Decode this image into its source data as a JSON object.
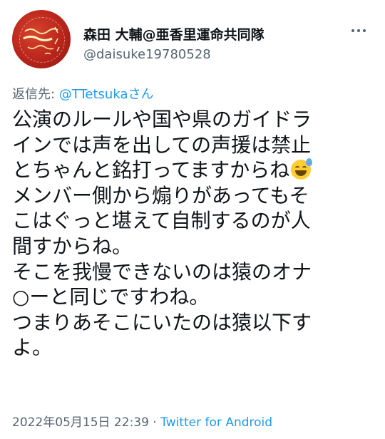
{
  "tweet": {
    "author": {
      "display_name": "森田 大輔@亜香里運命共同隊",
      "handle": "@daisuke19780528"
    },
    "reply": {
      "label": "返信先: ",
      "target": "@TTetsukaさん"
    },
    "body_lines": [
      "公演のルールや国や県のガイドラ",
      "インでは声を出しての声援は禁止",
      "とちゃんと銘打ってますからね",
      "メンバー側から煽りがあってもそ",
      "こはぐっと堪えて自制するのが人",
      "間すからね。",
      "そこを我慢できないのは猿のオナ",
      "○ーと同じですわね。",
      "つまりあそこにいたのは猿以下す",
      "よ。"
    ],
    "emoji": "grinning-face-with-sweat",
    "meta": {
      "timestamp": "2022年05月15日 22:39",
      "separator": " · ",
      "source": "Twitter for Android"
    }
  },
  "colors": {
    "text": "#0f1419",
    "secondary": "#536471",
    "link": "#1d9bf0",
    "avatar": "#c23224"
  }
}
